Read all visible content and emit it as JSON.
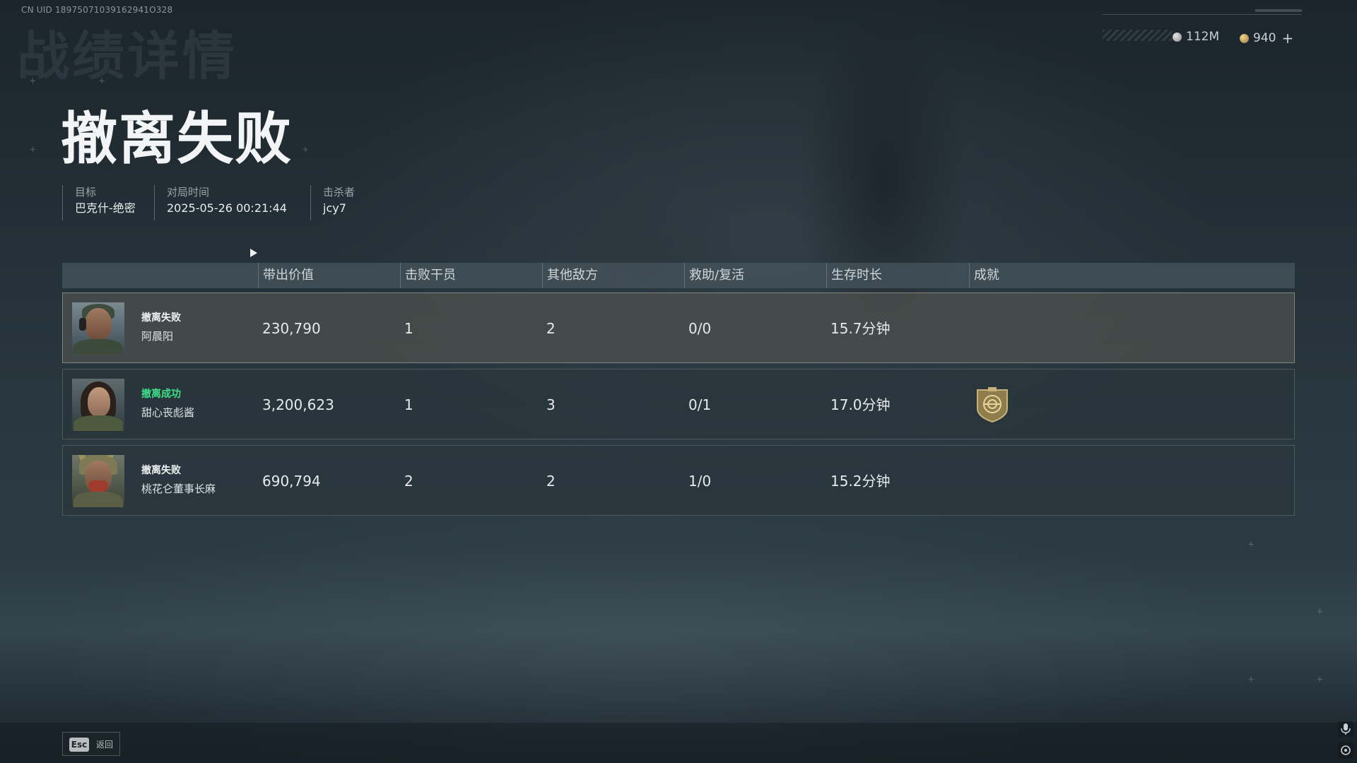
{
  "uid": "CN UID 18975071039162941O328",
  "background_title": "战绩详情",
  "currency": {
    "silver_amount": "112M",
    "gold_amount": "940",
    "add_symbol": "+"
  },
  "title": "撤离失败",
  "info": [
    {
      "label": "目标",
      "value": "巴克什-绝密"
    },
    {
      "label": "对局时间",
      "value": "2025-05-26 00:21:44"
    },
    {
      "label": "击杀者",
      "value": "jcy7"
    }
  ],
  "columns": [
    "带出价值",
    "击败干员",
    "其他敌方",
    "救助/复活",
    "生存时长",
    "成就"
  ],
  "rows": [
    {
      "status": "撤离失败",
      "status_type": "fail",
      "name": "阿晨阳",
      "value": "230,790",
      "kills": "1",
      "other": "2",
      "assist": "0/0",
      "time": "15.7分钟",
      "achievement": false
    },
    {
      "status": "撤离成功",
      "status_type": "success",
      "name": "甜心丧彪酱",
      "value": "3,200,623",
      "kills": "1",
      "other": "3",
      "assist": "0/1",
      "time": "17.0分钟",
      "achievement": true
    },
    {
      "status": "撤离失败",
      "status_type": "fail",
      "name": "桃花仑董事长麻",
      "value": "690,794",
      "kills": "2",
      "other": "2",
      "assist": "1/0",
      "time": "15.2分钟",
      "achievement": false
    }
  ],
  "footer": {
    "esc_key": "Esc",
    "back_label": "返回"
  },
  "colors": {
    "success_status": "#3ee08a",
    "badge_gold": "#b5a06a"
  }
}
